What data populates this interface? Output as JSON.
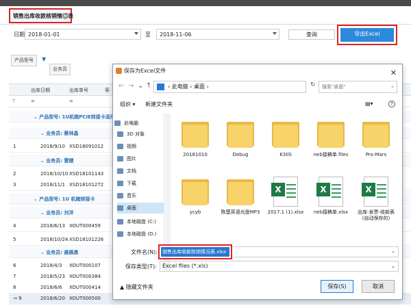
{
  "tab": {
    "title": "销售出库收款核销情况表"
  },
  "filter": {
    "date_label": "日期",
    "date_from": "2018-01-01",
    "to_label": "至",
    "date_to": "2018-11-06",
    "query_label": "查询",
    "export_label": "导出Excel"
  },
  "group": {
    "chip_product": "产品型号",
    "chip_sales": "业务员"
  },
  "grid": {
    "columns": [
      "出库日期",
      "出库单号",
      "客"
    ],
    "rows": [
      {
        "type": "g1",
        "text": "产品型号: 1U机箱PCIE转接卡适用于"
      },
      {
        "type": "g2",
        "text": "业务员: 蔡林晶"
      },
      {
        "type": "data",
        "num": "1",
        "date": "2018/9/10",
        "code": "XSD18091012"
      },
      {
        "type": "g2",
        "text": "业务员: 雷健"
      },
      {
        "type": "data",
        "num": "2",
        "date": "2018/10/10",
        "code": "XSD18101143"
      },
      {
        "type": "data",
        "num": "3",
        "date": "2018/11/1",
        "code": "XSD18101272"
      },
      {
        "type": "g1",
        "text": "产品型号: 1U 机箱转接卡"
      },
      {
        "type": "g2",
        "text": "业务员: 刘洋"
      },
      {
        "type": "data",
        "num": "4",
        "date": "2018/6/13",
        "code": "XOUT000459"
      },
      {
        "type": "data",
        "num": "5",
        "date": "2018/10/24",
        "code": "XSD18101226"
      },
      {
        "type": "g2",
        "text": "业务员: 聂佩勇"
      },
      {
        "type": "data",
        "num": "6",
        "date": "2018/4/3",
        "code": "XOUT000107"
      },
      {
        "type": "data",
        "num": "7",
        "date": "2018/5/23",
        "code": "XOUT000384"
      },
      {
        "type": "data",
        "num": "8",
        "date": "2018/6/6",
        "code": "XOUT000414"
      },
      {
        "type": "data",
        "num": "9",
        "date": "2018/6/20",
        "code": "XOUT000500"
      }
    ]
  },
  "dialog": {
    "title": "保存为Excel文件",
    "path": [
      "此电脑",
      "桌面"
    ],
    "search_placeholder": "搜索\"桌面\"",
    "organize": "组织 ▾",
    "new_folder": "新建文件夹",
    "sidebar": [
      "此电脑",
      "3D 对象",
      "视频",
      "图片",
      "文档",
      "下载",
      "音乐",
      "桌面",
      "本地磁盘 (C:)",
      "本地磁盘 (D:)"
    ],
    "files": [
      {
        "name": "20181010",
        "kind": "folder"
      },
      {
        "name": "Debug",
        "kind": "folder"
      },
      {
        "name": "K3IIS",
        "kind": "folder"
      },
      {
        "name": "neb接稿单.files",
        "kind": "folder"
      },
      {
        "name": "Pro-Mars",
        "kind": "folder"
      },
      {
        "name": "ycyb",
        "kind": "folder"
      },
      {
        "name": "陈楚英语光盘MP3",
        "kind": "folder"
      },
      {
        "name": "2017.1 (1).xlsx",
        "kind": "xls"
      },
      {
        "name": "neb接稿单.xlsx",
        "kind": "xls"
      },
      {
        "name": "出库-发票-收款表 (自动保存的)",
        "kind": "xls"
      }
    ],
    "filename_label": "文件名(N):",
    "filename_value": "销售出库收款核销情况表.xlsx",
    "filetype_label": "保存类型(T):",
    "filetype_value": "Excel files (*.xls)",
    "hide_folders": "隐藏文件夹",
    "save_label": "保存(S)",
    "cancel_label": "取消"
  }
}
